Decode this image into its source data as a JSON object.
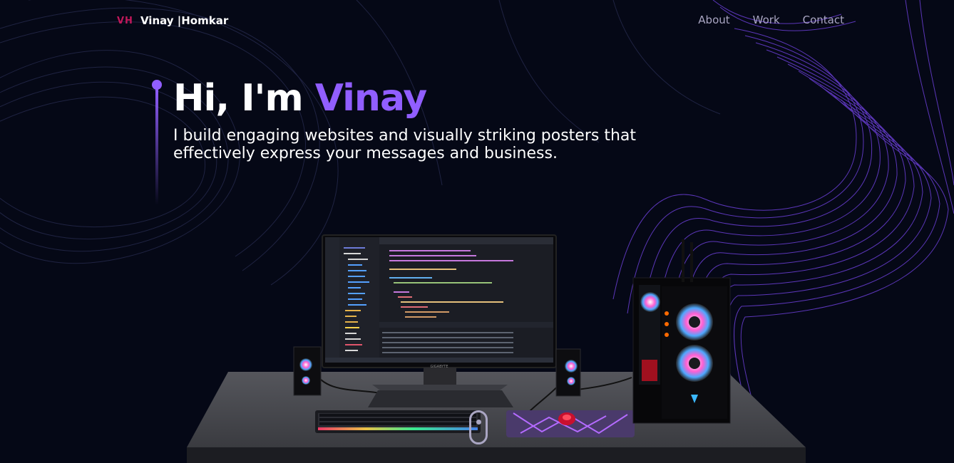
{
  "brand": {
    "monogram": "VH",
    "name": "Vinay |Homkar"
  },
  "nav": {
    "items": [
      "About",
      "Work",
      "Contact"
    ]
  },
  "hero": {
    "greeting": "Hi, I'm ",
    "name": "Vinay",
    "subtitle": "I build engaging websites and visually striking posters that effectively express your messages and business."
  },
  "monitor": {
    "brand": "GIGABYTE"
  },
  "colors": {
    "background": "#050816",
    "accent": "#915eff",
    "brand_mono": "#c2185b",
    "nav_text": "#aaa6c3"
  }
}
